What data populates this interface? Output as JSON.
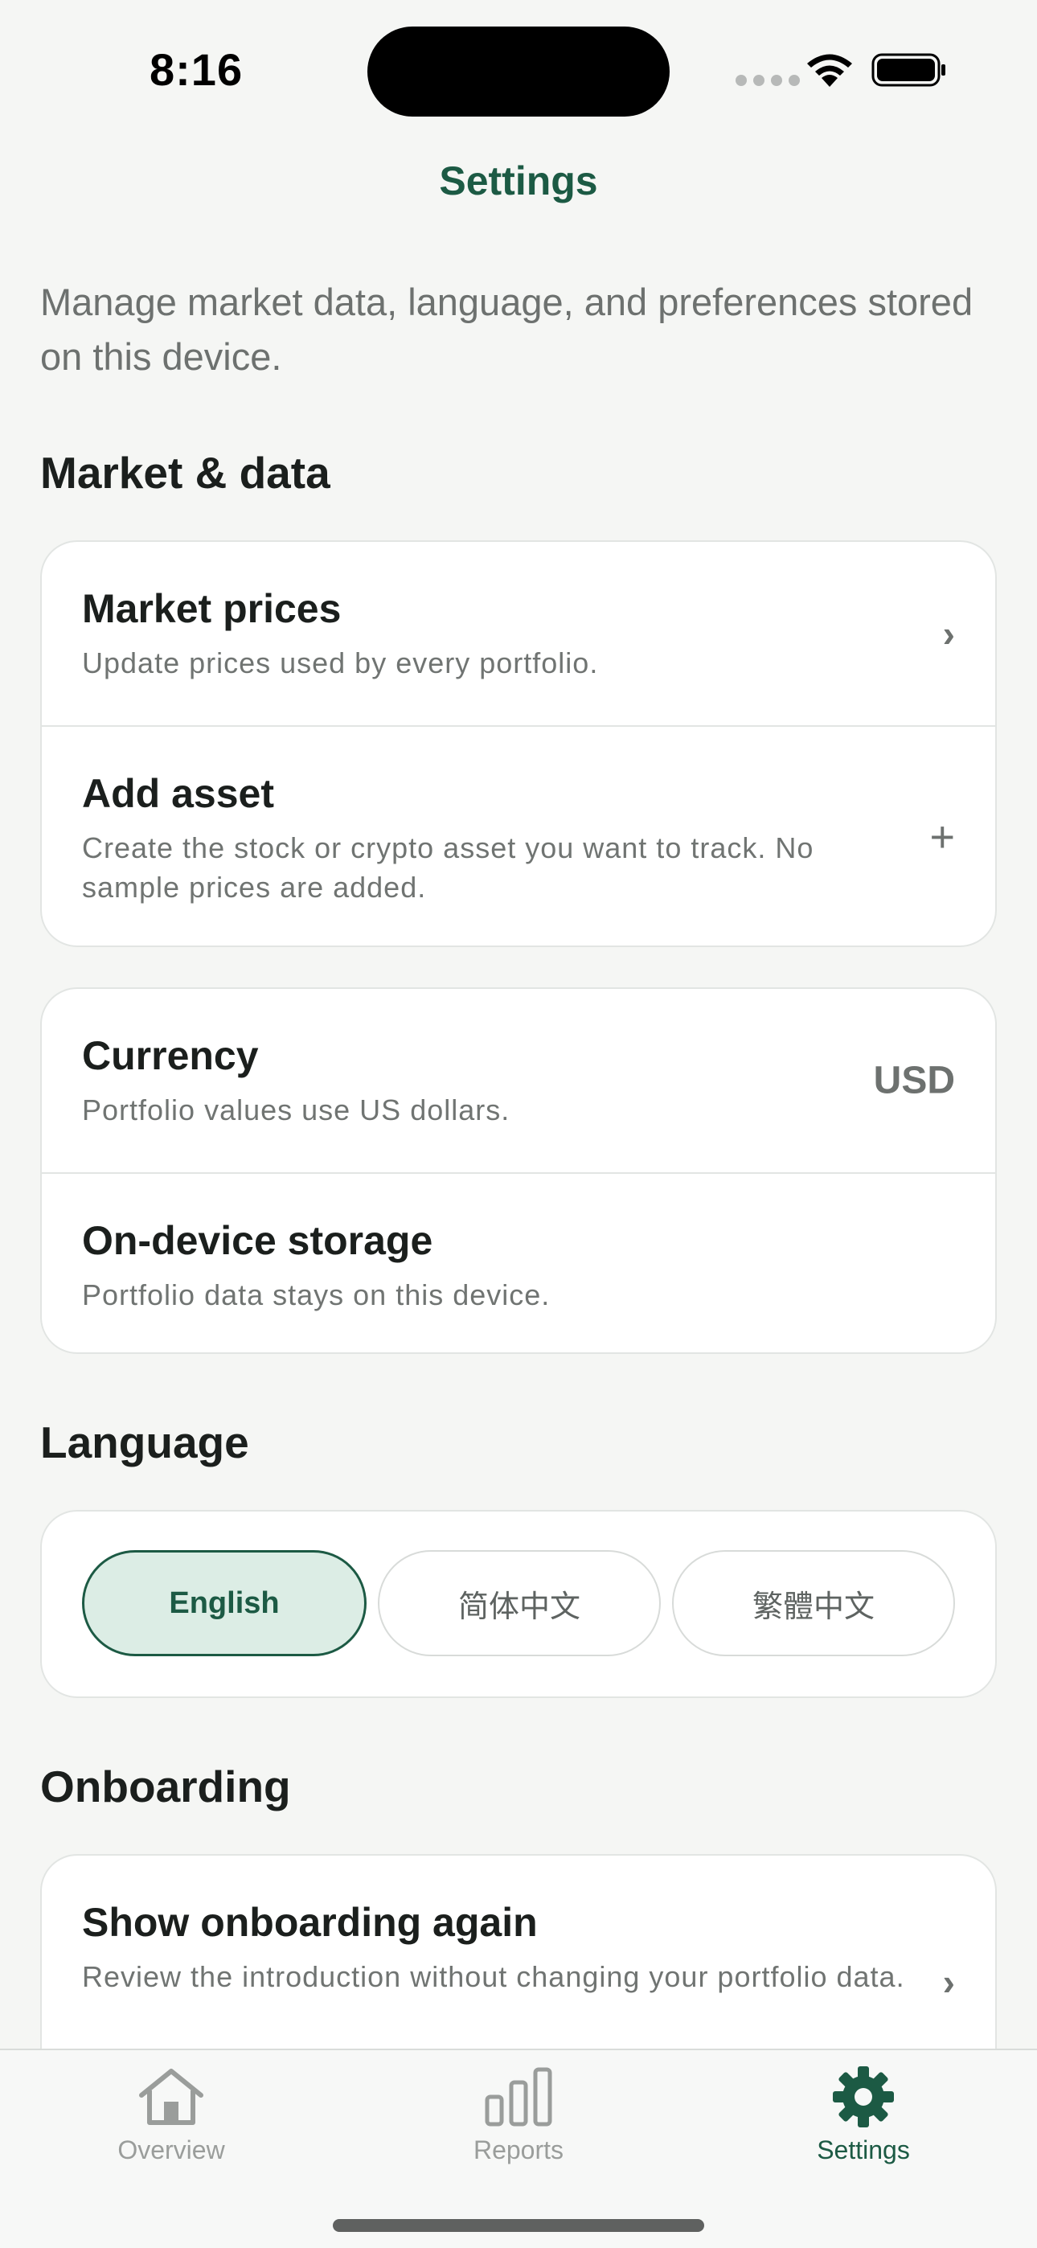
{
  "status_bar": {
    "time": "8:16"
  },
  "nav": {
    "title": "Settings"
  },
  "intro": "Manage market data, language, and preferences stored on this device.",
  "sections": {
    "market": {
      "title": "Market & data",
      "market_prices": {
        "title": "Market prices",
        "subtitle": "Update prices used by every portfolio."
      },
      "add_asset": {
        "title": "Add asset",
        "subtitle": "Create the stock or crypto asset you want to track. No sample prices are added."
      }
    },
    "currency": {
      "title": "Currency",
      "subtitle": "Portfolio values use US dollars.",
      "value": "USD"
    },
    "storage": {
      "title": "On-device storage",
      "subtitle": "Portfolio data stays on this device."
    },
    "language": {
      "title": "Language",
      "options": [
        "English",
        "简体中文",
        "繁體中文"
      ],
      "selected": "English"
    },
    "onboarding": {
      "title": "Onboarding",
      "show_again": {
        "title": "Show onboarding again",
        "subtitle": "Review the introduction without changing your portfolio data."
      }
    }
  },
  "tabs": [
    {
      "label": "Overview",
      "icon": "house-icon"
    },
    {
      "label": "Reports",
      "icon": "bar-chart-icon"
    },
    {
      "label": "Settings",
      "icon": "gear-icon",
      "active": true
    }
  ],
  "colors": {
    "accent": "#1c5a44",
    "selected_fill": "#dcede5",
    "background": "#f5f6f4"
  }
}
